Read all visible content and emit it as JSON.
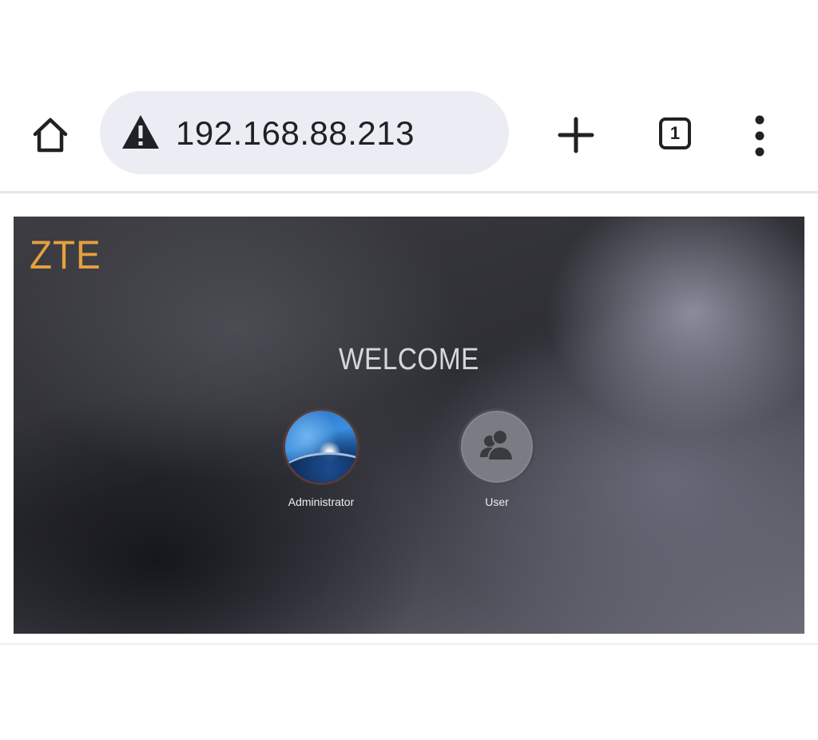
{
  "browser": {
    "address_bar": {
      "url": "192.168.88.213",
      "security_icon": "warning-triangle-icon"
    },
    "tab_count": "1",
    "icons": {
      "home": "home-icon",
      "new_tab": "plus-icon",
      "tabs": "tab-switcher-icon",
      "menu": "more-vertical-icon"
    }
  },
  "page": {
    "brand": "ZTE",
    "welcome": "WELCOME",
    "accounts": [
      {
        "label": "Administrator",
        "icon": "admin-avatar-icon"
      },
      {
        "label": "User",
        "icon": "users-icon"
      }
    ],
    "colors": {
      "brand": "#e6a03c",
      "omnibox_bg": "#ecedf4"
    }
  }
}
